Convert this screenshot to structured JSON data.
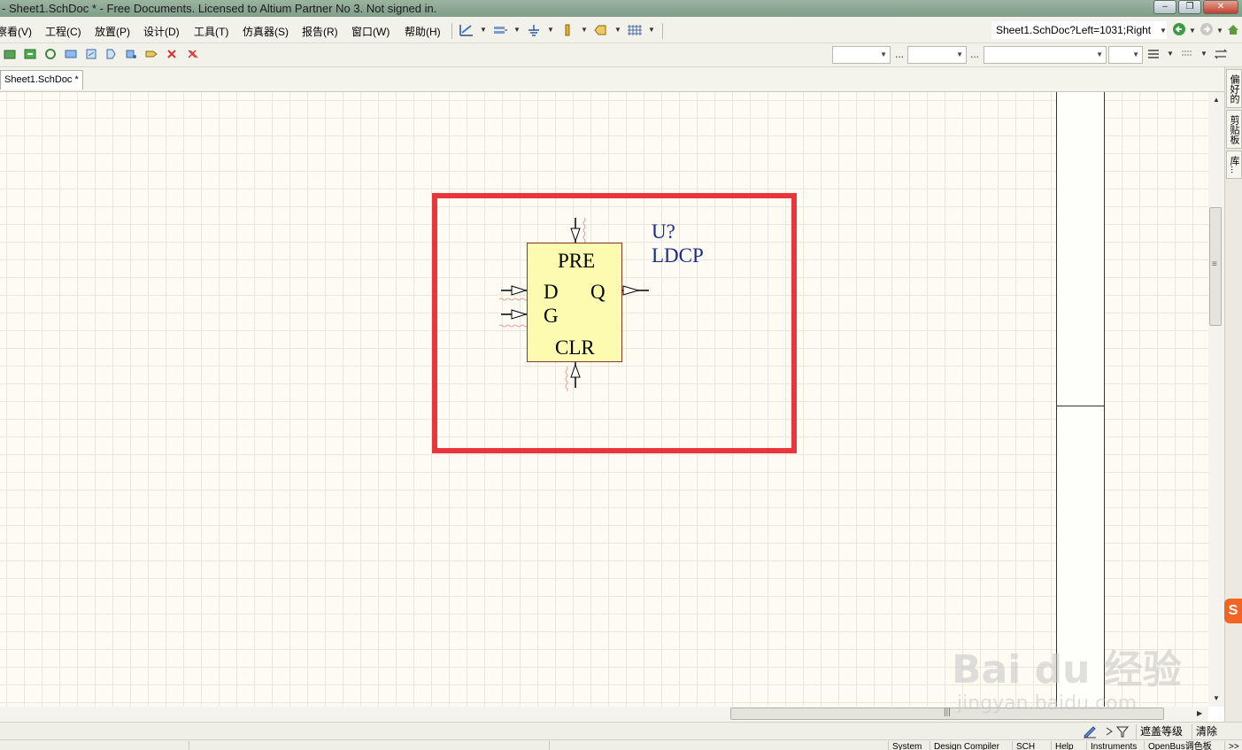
{
  "window": {
    "title": "- Sheet1.SchDoc * - Free Documents. Licensed to Altium Partner No 3. Not signed in.",
    "min_symbol": "–",
    "max_symbol": "❐",
    "close_symbol": "✕"
  },
  "menu": {
    "items": [
      "察看(V)",
      "工程(C)",
      "放置(P)",
      "设计(D)",
      "工具(T)",
      "仿真器(S)",
      "报告(R)",
      "窗口(W)",
      "帮助(H)"
    ]
  },
  "address": {
    "value": "Sheet1.SchDoc?Left=1031;Right"
  },
  "toolbar2": {
    "dots": "..."
  },
  "tabs": {
    "doc_tab": "Sheet1.SchDoc *"
  },
  "side_panel": {
    "tabs": [
      "偏好的",
      "剪贴板",
      "库..."
    ]
  },
  "component": {
    "designator": "U?",
    "comment": "LDCP",
    "pins": {
      "pre": "PRE",
      "d": "D",
      "q": "Q",
      "g": "G",
      "clr": "CLR"
    }
  },
  "statusbar": {
    "mask_level": "遮盖等级",
    "clear": "清除",
    "panels": [
      "System",
      "Design Compiler",
      "SCH",
      "Help",
      "Instruments",
      "OpenBus调色板"
    ],
    "more": ">>"
  },
  "watermark": {
    "logo": "Bai du 经验",
    "url": "jingyan.baidu.com"
  },
  "colors": {
    "highlight": "#e8363c",
    "component_fill": "#fdfbb0",
    "designator_text": "#1c2b8a",
    "canvas_bg": "#fdfbf2"
  }
}
